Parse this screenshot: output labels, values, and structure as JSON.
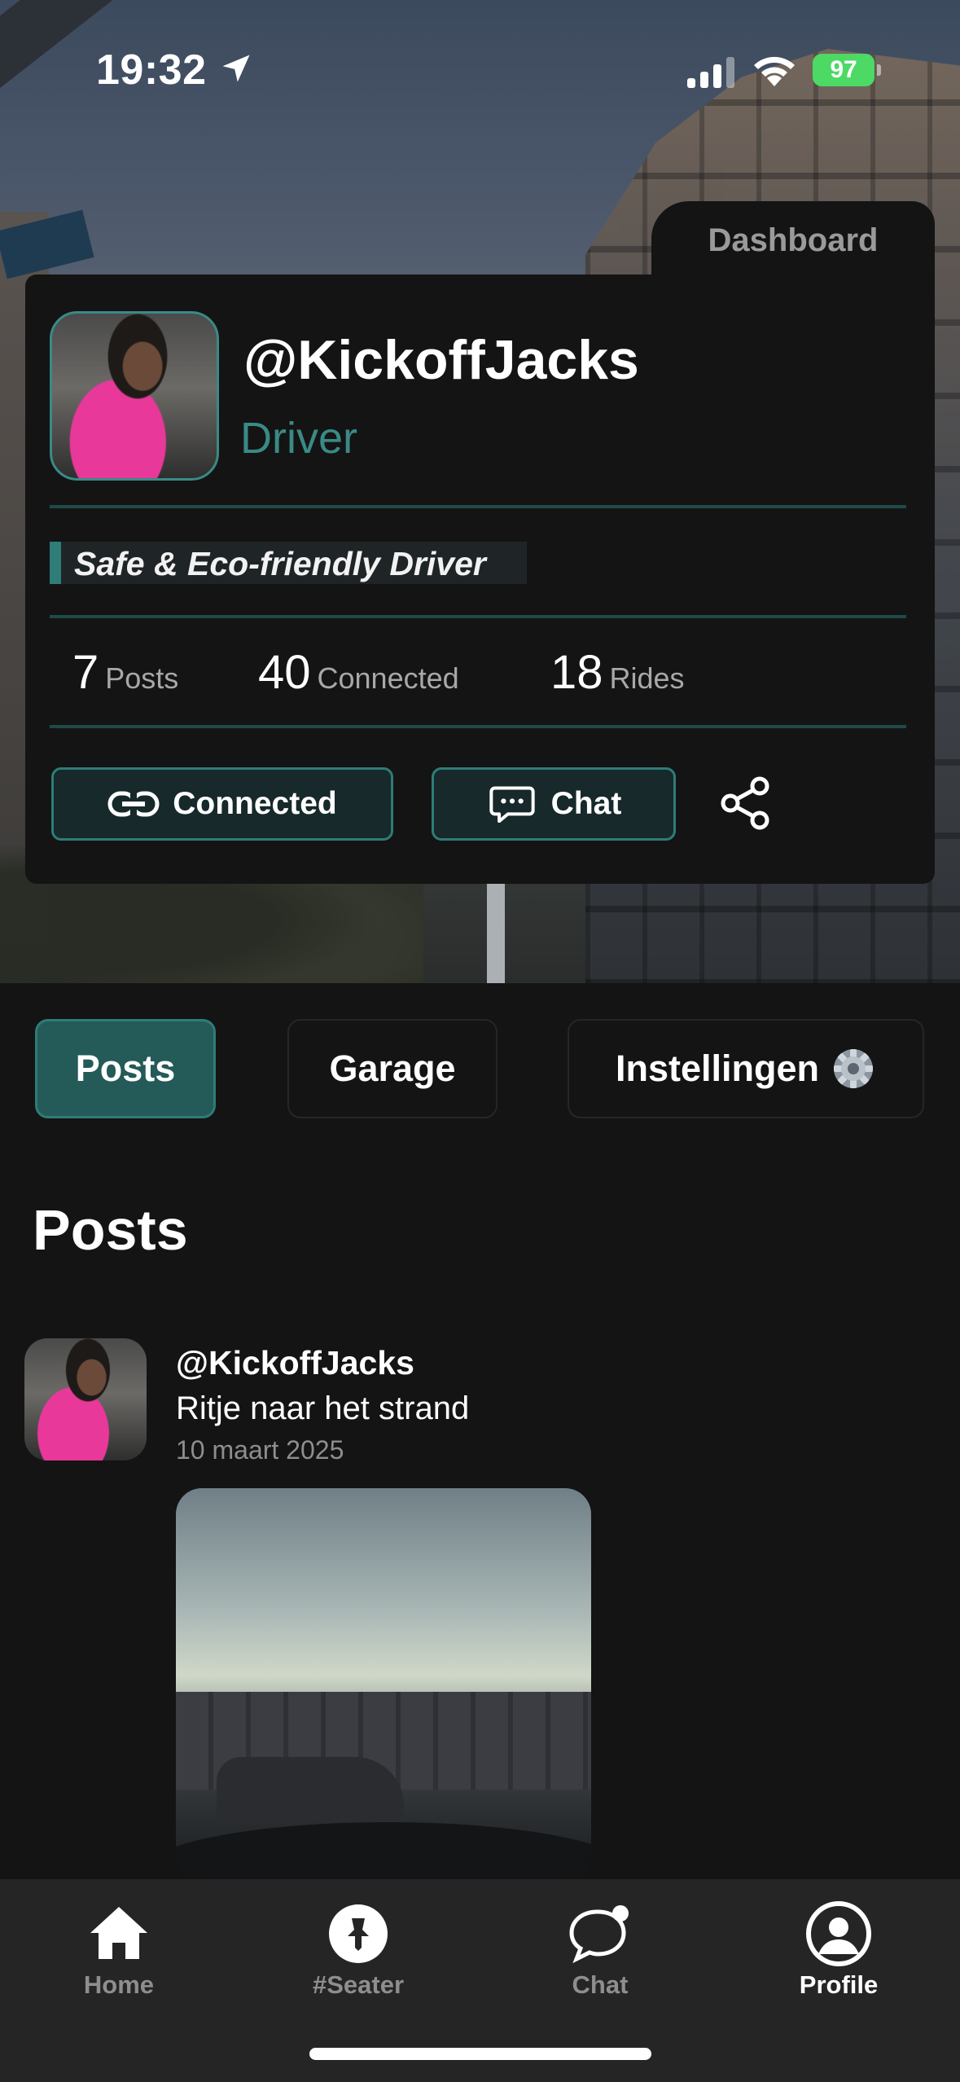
{
  "status_bar": {
    "time": "19:32",
    "battery": "97",
    "icons": [
      "location-arrow-icon",
      "cellular-signal-icon",
      "wifi-icon",
      "battery-charging-icon"
    ]
  },
  "profile": {
    "dashboard_tab": "Dashboard",
    "username": "@KickoffJacks",
    "role": "Driver",
    "tagline": "Safe & Eco-friendly Driver",
    "stats": [
      {
        "value": "7",
        "label": "Posts"
      },
      {
        "value": "40",
        "label": "Connected"
      },
      {
        "value": "18",
        "label": "Rides"
      }
    ],
    "connected_label": "Connected",
    "chat_label": "Chat"
  },
  "tabs": [
    {
      "label": "Posts",
      "active": true
    },
    {
      "label": "Garage",
      "active": false
    },
    {
      "label": "Instellingen",
      "active": false
    }
  ],
  "section_title": "Posts",
  "post": {
    "username": "@KickoffJacks",
    "text": "Ritje naar het strand",
    "date": "10 maart 2025"
  },
  "bottom_nav": [
    {
      "label": "Home",
      "icon": "home-icon",
      "active": false
    },
    {
      "label": "#Seater",
      "icon": "pin-icon",
      "active": false
    },
    {
      "label": "Chat",
      "icon": "chat-bubble-icon",
      "active": false
    },
    {
      "label": "Profile",
      "icon": "profile-icon",
      "active": true
    }
  ],
  "colors": {
    "accent": "#2f7c78",
    "role_text": "#3a8a86",
    "background": "#141414",
    "battery": "#4cd964"
  }
}
